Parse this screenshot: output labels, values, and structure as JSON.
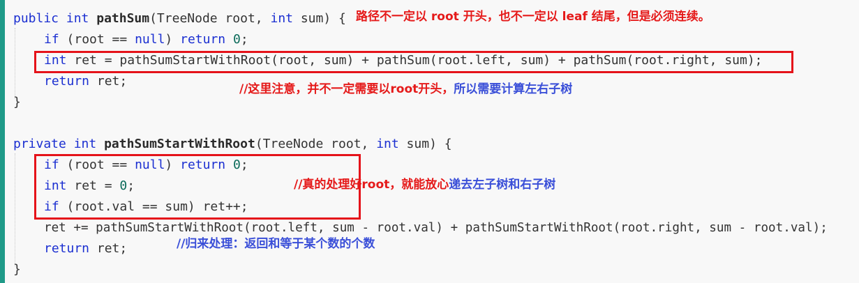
{
  "colors": {
    "keyword": "#1b2fd1",
    "highlight_box": "#e5131a",
    "note_red": "#e51a1a",
    "note_blue": "#3a4fd8",
    "gutter": "#1f9a88",
    "background": "#f8f8f8"
  },
  "code": {
    "l1": {
      "kw1": "public",
      "kw2": "int",
      "fn": "pathSum",
      "rest1": "(TreeNode root, ",
      "kw3": "int",
      "rest2": " sum) {"
    },
    "l2": {
      "kw1": "if",
      "rest1": " (root == ",
      "kw2": "null",
      "rest2": ") ",
      "kw3": "return",
      "rest3": " ",
      "num": "0",
      "end": ";"
    },
    "l3": {
      "kw1": "int",
      "rest": " ret = pathSumStartWithRoot(root, sum) + pathSum(root.left, sum) + pathSum(root.right, sum);"
    },
    "l4": {
      "kw1": "return",
      "rest": " ret;"
    },
    "l5": {
      "text": "}"
    },
    "l7": {
      "kw1": "private",
      "kw2": "int",
      "fn": "pathSumStartWithRoot",
      "rest1": "(TreeNode root, ",
      "kw3": "int",
      "rest2": " sum) {"
    },
    "l8": {
      "kw1": "if",
      "rest1": " (root == ",
      "kw2": "null",
      "rest2": ") ",
      "kw3": "return",
      "rest3": " ",
      "num": "0",
      "end": ";"
    },
    "l9": {
      "kw1": "int",
      "rest": " ret = ",
      "num": "0",
      "end": ";"
    },
    "l10": {
      "kw1": "if",
      "rest": " (root.val == sum) ret++;"
    },
    "l11": {
      "text": "ret += pathSumStartWithRoot(root.left, sum - root.val) + pathSumStartWithRoot(root.right, sum - root.val);"
    },
    "l12": {
      "kw1": "return",
      "rest": " ret;"
    },
    "l13": {
      "text": "}"
    }
  },
  "notes": {
    "n1": "路径不一定以 root 开头，也不一定以 leaf 结尾，但是必须连续。",
    "n2a": "//这里注意，并不一定需要以root开头，",
    "n2b": "所以需要计算左右子树",
    "n3a": "//真的处理好root，就能放心",
    "n3b": "递去左子树和右子树",
    "n4": "//归来处理：返回和等于某个数的个数"
  }
}
